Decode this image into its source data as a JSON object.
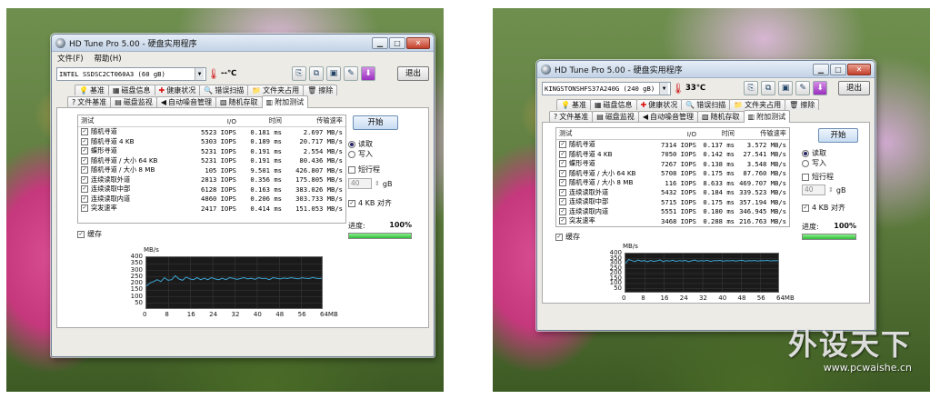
{
  "left": {
    "window_title": "HD Tune Pro 5.00 - 硬盘实用程序",
    "menu": [
      "文件(F)",
      "帮助(H)"
    ],
    "drive": "INTEL   SSDSC2CT060A3  (60 gB)",
    "temperature": "--℃",
    "exit_label": "退出",
    "tabs_row1": [
      "基准",
      "磁盘信息",
      "健康状况",
      "错误扫描",
      "文件夹占用",
      "擦除"
    ],
    "tabs_row2": [
      "文件基准",
      "磁盘监视",
      "自动噪音管理",
      "随机存取",
      "附加测试"
    ],
    "table_headers": [
      "测试",
      "I/O",
      "时间",
      "传输速率"
    ],
    "rows": [
      {
        "name": "随机寻道",
        "io": "5523 IOPS",
        "time": "0.181 ms",
        "rate": "2.697 MB/s"
      },
      {
        "name": "随机寻道 4 KB",
        "io": "5303 IOPS",
        "time": "0.189 ms",
        "rate": "20.717 MB/s"
      },
      {
        "name": "蝶形寻道",
        "io": "5231 IOPS",
        "time": "0.191 ms",
        "rate": "2.554 MB/s"
      },
      {
        "name": "随机寻道 / 大小 64 KB",
        "io": "5231 IOPS",
        "time": "0.191 ms",
        "rate": "80.436 MB/s"
      },
      {
        "name": "随机寻道 / 大小 8 MB",
        "io": "105 IOPS",
        "time": "9.501 ms",
        "rate": "426.807 MB/s"
      },
      {
        "name": "连续读取外道",
        "io": "2813 IOPS",
        "time": "0.356 ms",
        "rate": "175.805 MB/s"
      },
      {
        "name": "连续读取中部",
        "io": "6128 IOPS",
        "time": "0.163 ms",
        "rate": "383.026 MB/s"
      },
      {
        "name": "连续读取内道",
        "io": "4860 IOPS",
        "time": "0.206 ms",
        "rate": "303.733 MB/s"
      },
      {
        "name": "突发速率",
        "io": "2417 IOPS",
        "time": "0.414 ms",
        "rate": "151.053 MB/s"
      }
    ],
    "start_label": "开始",
    "read_label": "读取",
    "write_label": "写入",
    "short_stroke_label": "短行程",
    "short_stroke_value": "40",
    "short_stroke_unit": "gB",
    "align_label": "4 KB 对齐",
    "progress_label": "进度:",
    "progress_value": "100%",
    "progress_fraction": 1.0,
    "cache_label": "缓存",
    "graph_unit": "MB/s",
    "graph_y_ticks": [
      "400",
      "350",
      "300",
      "250",
      "200",
      "150",
      "100",
      "50"
    ],
    "graph_x_ticks": [
      "0",
      "8",
      "16",
      "24",
      "32",
      "40",
      "48",
      "56",
      "64MB"
    ],
    "graph_series": [
      180,
      205,
      215,
      230,
      215,
      245,
      225,
      230,
      260,
      235,
      225,
      250,
      235,
      230,
      245,
      230,
      240,
      230,
      245,
      235,
      230,
      240,
      230,
      245,
      240,
      232,
      238,
      245,
      235,
      240,
      232,
      245,
      238,
      240,
      230,
      245,
      240,
      235,
      242,
      238,
      245,
      240,
      236,
      244,
      240,
      238,
      246,
      240,
      238,
      245
    ]
  },
  "right": {
    "window_title": "HD Tune Pro 5.00 - 硬盘实用程序",
    "drive": "KINGSTONSHFS37A240G  (240 gB)",
    "temperature": "33℃",
    "exit_label": "退出",
    "tabs_row1": [
      "基准",
      "磁盘信息",
      "健康状况",
      "错误扫描",
      "文件夹占用",
      "擦除"
    ],
    "tabs_row2": [
      "文件基准",
      "磁盘监视",
      "自动噪音管理",
      "随机存取",
      "附加测试"
    ],
    "table_headers": [
      "测试",
      "I/O",
      "时间",
      "传输速率"
    ],
    "rows": [
      {
        "name": "随机寻道",
        "io": "7314 IOPS",
        "time": "0.137 ms",
        "rate": "3.572 MB/s"
      },
      {
        "name": "随机寻道 4 KB",
        "io": "7050 IOPS",
        "time": "0.142 ms",
        "rate": "27.541 MB/s"
      },
      {
        "name": "蝶形寻道",
        "io": "7267 IOPS",
        "time": "0.138 ms",
        "rate": "3.548 MB/s"
      },
      {
        "name": "随机寻道 / 大小 64 KB",
        "io": "5708 IOPS",
        "time": "0.175 ms",
        "rate": "87.760 MB/s"
      },
      {
        "name": "随机寻道 / 大小 8 MB",
        "io": "116 IOPS",
        "time": "8.633 ms",
        "rate": "469.707 MB/s"
      },
      {
        "name": "连续读取外道",
        "io": "5432 IOPS",
        "time": "0.184 ms",
        "rate": "339.523 MB/s"
      },
      {
        "name": "连续读取中部",
        "io": "5715 IOPS",
        "time": "0.175 ms",
        "rate": "357.194 MB/s"
      },
      {
        "name": "连续读取内道",
        "io": "5551 IOPS",
        "time": "0.180 ms",
        "rate": "346.945 MB/s"
      },
      {
        "name": "突发速率",
        "io": "3468 IOPS",
        "time": "0.288 ms",
        "rate": "216.763 MB/s"
      }
    ],
    "start_label": "开始",
    "read_label": "读取",
    "write_label": "写入",
    "short_stroke_label": "短行程",
    "short_stroke_value": "40",
    "short_stroke_unit": "gB",
    "align_label": "4 KB 对齐",
    "progress_label": "进度:",
    "progress_value": "100%",
    "progress_fraction": 1.0,
    "cache_label": "缓存",
    "graph_unit": "MB/s",
    "graph_y_ticks": [
      "400",
      "350",
      "300",
      "250",
      "200",
      "150",
      "100",
      "50"
    ],
    "graph_x_ticks": [
      "0",
      "8",
      "16",
      "24",
      "32",
      "40",
      "48",
      "56",
      "64MB"
    ],
    "graph_series": [
      300,
      340,
      330,
      320,
      335,
      325,
      330,
      318,
      332,
      322,
      328,
      336,
      320,
      330,
      325,
      334,
      322,
      330,
      326,
      332,
      320,
      328,
      335,
      324,
      330,
      326,
      333,
      322,
      330,
      328,
      332,
      324,
      330,
      327,
      331,
      325,
      329,
      333,
      324,
      330,
      327,
      331,
      325,
      330,
      328,
      332,
      326,
      330,
      328,
      331
    ]
  },
  "watermark": {
    "brand": "外设天下",
    "url": "www.pcwaishe.cn"
  }
}
